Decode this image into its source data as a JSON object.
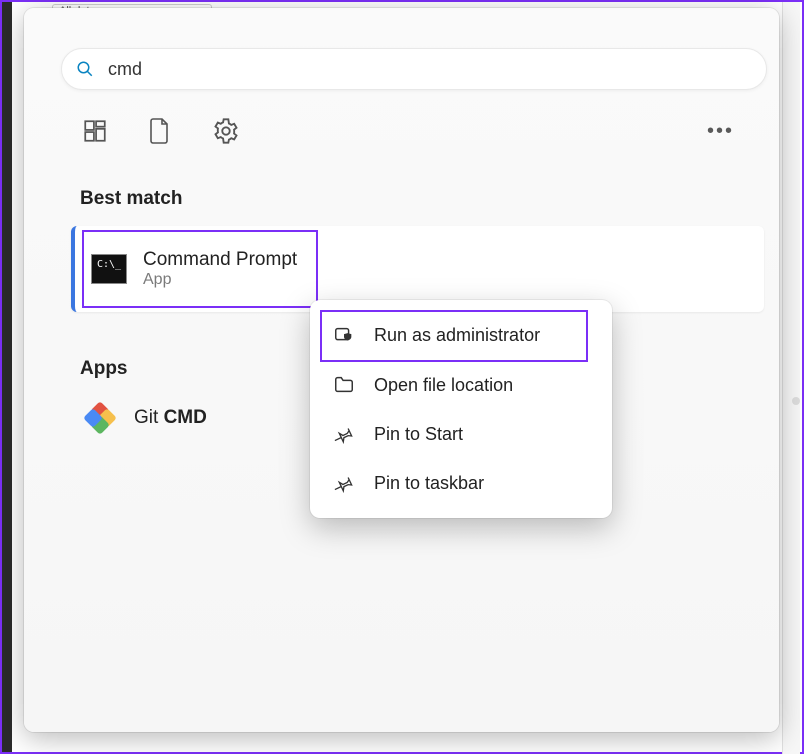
{
  "dropdown_stub": {
    "label": "All dates"
  },
  "search": {
    "value": "cmd",
    "placeholder": ""
  },
  "sections": {
    "best_match": "Best match",
    "apps": "Apps"
  },
  "best": {
    "title": "Command Prompt",
    "subtitle": "App",
    "icon_text": "C:\\_"
  },
  "apps_list": {
    "git": {
      "prefix": "Git ",
      "bold": "CMD"
    }
  },
  "context_menu": {
    "run_admin": "Run as administrator",
    "open_location": "Open file location",
    "pin_start": "Pin to Start",
    "pin_taskbar": "Pin to taskbar"
  },
  "more_dots": "•••"
}
